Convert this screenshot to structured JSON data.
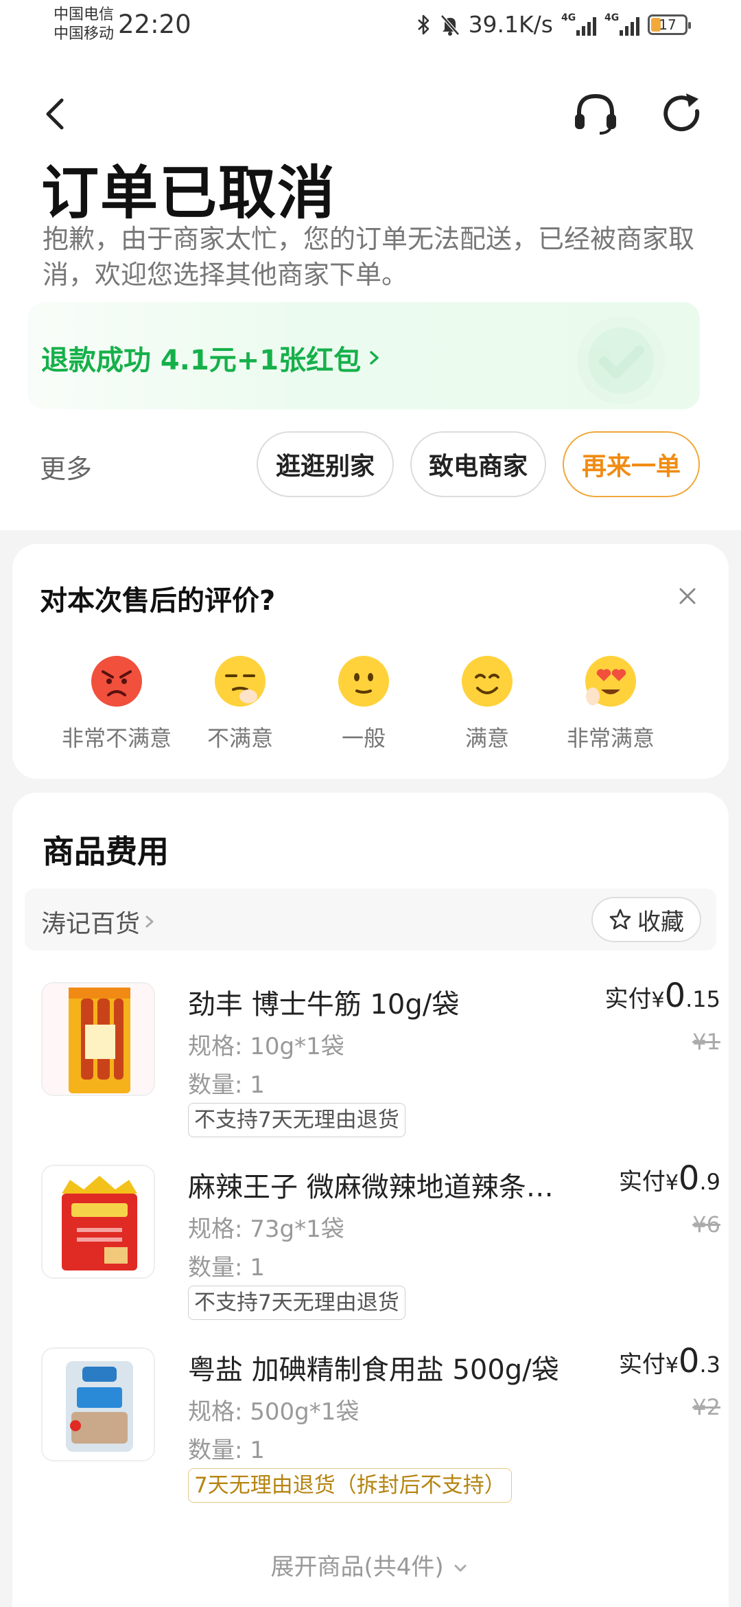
{
  "status_bar": {
    "carrier_1": "中国电信",
    "carrier_2": "中国移动",
    "time": "22:20",
    "net_speed": "39.1K/s",
    "network_1": "4G",
    "network_2": "4G",
    "battery": "17",
    "battery_color": "#f2a93b"
  },
  "header": {
    "title": "订单已取消",
    "subtitle": "抱歉，由于商家太忙，您的订单无法配送，已经被商家取消，欢迎您选择其他商家下单。",
    "icons": [
      "back-icon",
      "headset-icon",
      "refresh-icon"
    ]
  },
  "refund": {
    "text": "退款成功 4.1元+1张红包",
    "color": "#16b04a"
  },
  "actions": {
    "more_label": "更多",
    "browse_label": "逛逛别家",
    "call_label": "致电商家",
    "reorder_label": "再来一单",
    "accent": "#f08c14"
  },
  "rating": {
    "title": "对本次售后的评价?",
    "options": [
      {
        "label": "非常不满意",
        "icon": "angry-face-icon"
      },
      {
        "label": "不满意",
        "icon": "unamused-face-icon"
      },
      {
        "label": "一般",
        "icon": "neutral-face-icon"
      },
      {
        "label": "满意",
        "icon": "smiling-face-icon"
      },
      {
        "label": "非常满意",
        "icon": "heart-eyes-face-icon"
      }
    ]
  },
  "products": {
    "section_title": "商品费用",
    "shop_name": "涛记百货",
    "favorite_label": "收藏",
    "paid_prefix": "实付",
    "currency": "¥",
    "items": [
      {
        "name": "劲丰 博士牛筋 10g/袋",
        "spec": "规格: 10g*1袋",
        "qty": "数量: 1",
        "tag": "不支持7天无理由退货",
        "paid_int": "0",
        "paid_dec": ".15",
        "original": "¥1"
      },
      {
        "name": "麻辣王子 微麻微辣地道辣条…",
        "spec": "规格: 73g*1袋",
        "qty": "数量: 1",
        "tag": "不支持7天无理由退货",
        "paid_int": "0",
        "paid_dec": ".9",
        "original": "¥6"
      },
      {
        "name": "粤盐 加碘精制食用盐 500g/袋",
        "spec": "规格: 500g*1袋",
        "qty": "数量: 1",
        "tag": "7天无理由退货（拆封后不支持）",
        "paid_int": "0",
        "paid_dec": ".3",
        "original": "¥2"
      }
    ],
    "expand_label": "展开商品(共4件)"
  }
}
